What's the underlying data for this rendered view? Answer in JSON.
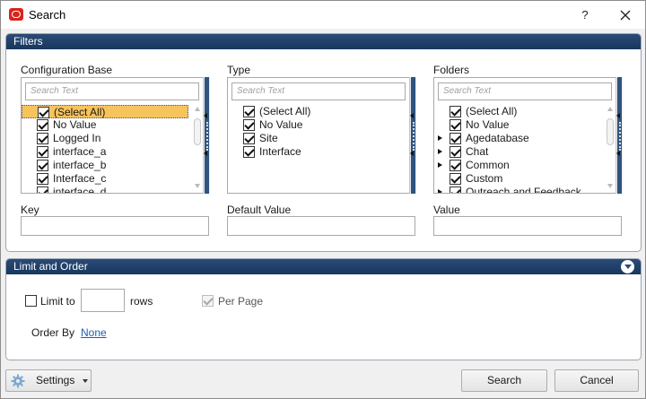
{
  "window": {
    "title": "Search",
    "help_label": "?"
  },
  "filters": {
    "header": "Filters",
    "columns": [
      {
        "label": "Configuration Base",
        "search_placeholder": "Search Text",
        "items": [
          {
            "label": "(Select All)",
            "checked": true,
            "selected": true,
            "expandable": false
          },
          {
            "label": "No Value",
            "checked": true,
            "selected": false,
            "expandable": false
          },
          {
            "label": "Logged In",
            "checked": true,
            "selected": false,
            "expandable": false
          },
          {
            "label": "interface_a",
            "checked": true,
            "selected": false,
            "expandable": false
          },
          {
            "label": "interface_b",
            "checked": true,
            "selected": false,
            "expandable": false
          },
          {
            "label": "Interface_c",
            "checked": true,
            "selected": false,
            "expandable": false
          },
          {
            "label": "interface_d",
            "checked": true,
            "selected": false,
            "expandable": false
          }
        ],
        "field_label": "Key",
        "field_value": ""
      },
      {
        "label": "Type",
        "search_placeholder": "Search Text",
        "items": [
          {
            "label": "(Select All)",
            "checked": true,
            "selected": false,
            "expandable": false
          },
          {
            "label": "No Value",
            "checked": true,
            "selected": false,
            "expandable": false
          },
          {
            "label": "Site",
            "checked": true,
            "selected": false,
            "expandable": false
          },
          {
            "label": "Interface",
            "checked": true,
            "selected": false,
            "expandable": false
          }
        ],
        "field_label": "Default Value",
        "field_value": ""
      },
      {
        "label": "Folders",
        "search_placeholder": "Search Text",
        "items": [
          {
            "label": "(Select All)",
            "checked": true,
            "selected": false,
            "expandable": false
          },
          {
            "label": "No Value",
            "checked": true,
            "selected": false,
            "expandable": false
          },
          {
            "label": "Agedatabase",
            "checked": true,
            "selected": false,
            "expandable": true
          },
          {
            "label": "Chat",
            "checked": true,
            "selected": false,
            "expandable": true
          },
          {
            "label": "Common",
            "checked": true,
            "selected": false,
            "expandable": true
          },
          {
            "label": "Custom",
            "checked": true,
            "selected": false,
            "expandable": false
          },
          {
            "label": "Outreach and Feedback",
            "checked": true,
            "selected": false,
            "expandable": true
          }
        ],
        "field_label": "Value",
        "field_value": ""
      }
    ]
  },
  "limit_order": {
    "header": "Limit and Order",
    "limit_to_label": "Limit to",
    "limit_checked": false,
    "limit_value": "",
    "rows_label": "rows",
    "per_page_label": "Per Page",
    "per_page_checked": true,
    "order_by_label": "Order By",
    "order_by_value": "None"
  },
  "footer": {
    "settings_label": "Settings",
    "search_label": "Search",
    "cancel_label": "Cancel"
  }
}
